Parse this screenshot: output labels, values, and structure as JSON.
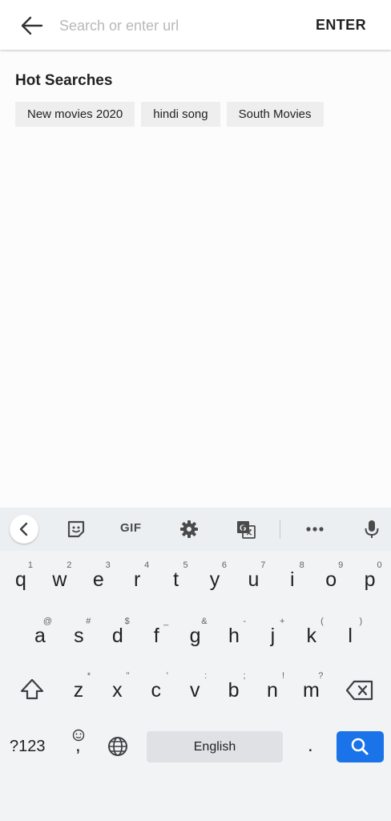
{
  "header": {
    "back_icon": "arrow-left-icon",
    "search_placeholder": "Search or enter url",
    "enter_label": "ENTER"
  },
  "hot_searches": {
    "title": "Hot Searches",
    "items": [
      "New movies 2020",
      "hindi song",
      "South Movies"
    ]
  },
  "keyboard": {
    "toolbar": {
      "collapse_icon": "chevron-left-icon",
      "sticker_icon": "sticker-icon",
      "gif_label": "GIF",
      "settings_icon": "gear-icon",
      "translate_icon": "translate-icon",
      "more_icon": "more-dots-icon",
      "mic_icon": "microphone-icon"
    },
    "row1": [
      {
        "key": "q",
        "hint": "1"
      },
      {
        "key": "w",
        "hint": "2"
      },
      {
        "key": "e",
        "hint": "3"
      },
      {
        "key": "r",
        "hint": "4"
      },
      {
        "key": "t",
        "hint": "5"
      },
      {
        "key": "y",
        "hint": "6"
      },
      {
        "key": "u",
        "hint": "7"
      },
      {
        "key": "i",
        "hint": "8"
      },
      {
        "key": "o",
        "hint": "9"
      },
      {
        "key": "p",
        "hint": "0"
      }
    ],
    "row2": [
      {
        "key": "a",
        "hint": "@"
      },
      {
        "key": "s",
        "hint": "#"
      },
      {
        "key": "d",
        "hint": "$"
      },
      {
        "key": "f",
        "hint": "_"
      },
      {
        "key": "g",
        "hint": "&"
      },
      {
        "key": "h",
        "hint": "-"
      },
      {
        "key": "j",
        "hint": "+"
      },
      {
        "key": "k",
        "hint": "("
      },
      {
        "key": "l",
        "hint": ")"
      }
    ],
    "row3": [
      {
        "key": "z",
        "hint": "*"
      },
      {
        "key": "x",
        "hint": "\""
      },
      {
        "key": "c",
        "hint": "'"
      },
      {
        "key": "v",
        "hint": ":"
      },
      {
        "key": "b",
        "hint": ";"
      },
      {
        "key": "n",
        "hint": "!"
      },
      {
        "key": "m",
        "hint": "?"
      }
    ],
    "shift_icon": "shift-icon",
    "backspace_icon": "backspace-icon",
    "symbols_label": "?123",
    "emoji_comma_label": ",",
    "emoji_icon": "emoji-icon",
    "globe_icon": "globe-icon",
    "space_label": "English",
    "period_label": ".",
    "search_icon": "search-icon"
  }
}
